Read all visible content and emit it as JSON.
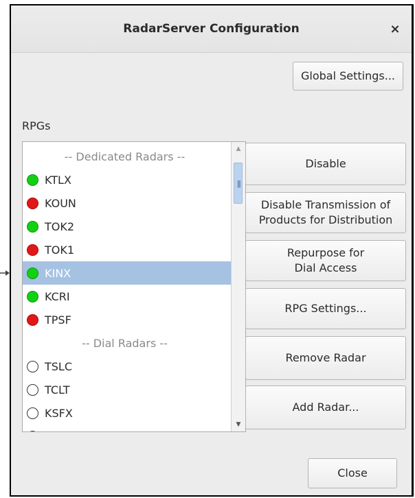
{
  "window": {
    "title": "RadarServer Configuration",
    "close_label": "×"
  },
  "global_settings_label": "Global Settings...",
  "rpgs_label": "RPGs",
  "list": {
    "rows": [
      {
        "type": "header",
        "label": "-- Dedicated Radars --"
      },
      {
        "type": "radar",
        "label": "KTLX",
        "status": "green"
      },
      {
        "type": "radar",
        "label": "KOUN",
        "status": "red"
      },
      {
        "type": "radar",
        "label": "TOK2",
        "status": "green"
      },
      {
        "type": "radar",
        "label": "TOK1",
        "status": "red"
      },
      {
        "type": "radar",
        "label": "KINX",
        "status": "green",
        "selected": true
      },
      {
        "type": "radar",
        "label": "KCRI",
        "status": "green"
      },
      {
        "type": "radar",
        "label": "TPSF",
        "status": "red"
      },
      {
        "type": "header",
        "label": "-- Dial Radars --"
      },
      {
        "type": "radar",
        "label": "TSLC",
        "status": "empty"
      },
      {
        "type": "radar",
        "label": "TCLT",
        "status": "empty"
      },
      {
        "type": "radar",
        "label": "KSFX",
        "status": "empty"
      },
      {
        "type": "radar",
        "label": "",
        "status": "empty"
      }
    ]
  },
  "actions": {
    "disable": "Disable",
    "disable_transmission": "Disable Transmission of\nProducts for Distribution",
    "repurpose": "Repurpose for\nDial Access",
    "rpg_settings": "RPG Settings...",
    "remove_radar": "Remove Radar",
    "add_radar": "Add Radar..."
  },
  "close_label": "Close",
  "colors": {
    "green": "#12d012",
    "red": "#e21717",
    "selection": "#a6c2e3"
  }
}
